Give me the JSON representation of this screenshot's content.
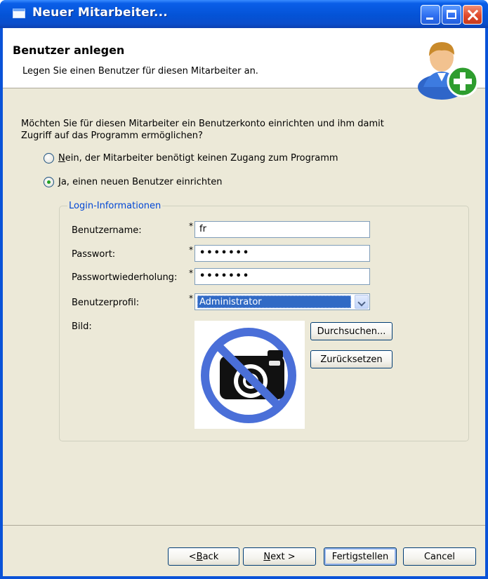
{
  "window": {
    "title": "Neuer Mitarbeiter..."
  },
  "header": {
    "title": "Benutzer anlegen",
    "subtitle": "Legen Sie einen Benutzer für diesen Mitarbeiter an.",
    "icon": "user-add-icon"
  },
  "question": {
    "line1": "Möchten Sie für diesen Mitarbeiter ein Benutzerkonto einrichten und ihm damit",
    "line2": "Zugriff auf das Programm ermöglichen?"
  },
  "options": {
    "no": {
      "mnemonic": "N",
      "label": "ein, der Mitarbeiter benötigt keinen Zugang zum Programm",
      "checked": false
    },
    "yes": {
      "mnemonic": "J",
      "label": "a, einen neuen Benutzer einrichten",
      "checked": true
    }
  },
  "login": {
    "legend": "Login-Informationen",
    "required_marker": "*",
    "username_label": "Benutzername:",
    "username_value": "fr",
    "password_label": "Passwort:",
    "password_value": "•••••••",
    "password_repeat_label": "Passwortwiederholung:",
    "password_repeat_value": "•••••••",
    "profile_label": "Benutzerprofil:",
    "profile_value": "Administrator",
    "image_label": "Bild:",
    "image_placeholder_icon": "no-camera-icon",
    "browse_button": "Durchsuchen...",
    "reset_button": "Zurücksetzen"
  },
  "footer": {
    "back": {
      "pre": "< ",
      "mnemonic": "B",
      "post": "ack"
    },
    "next": {
      "mnemonic": "N",
      "post": "ext >"
    },
    "finish": "Fertigstellen",
    "cancel": "Cancel"
  },
  "colors": {
    "titlebar": "#0453d6",
    "dialog_bg": "#ece9d8",
    "legend": "#0046d5",
    "selection": "#316ac5"
  }
}
